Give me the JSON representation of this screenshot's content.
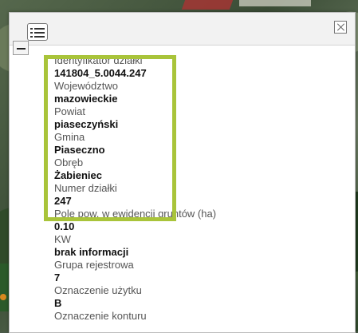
{
  "popup": {
    "fields": [
      {
        "label": "Identyfikator działki",
        "value": "141804_5.0044.247"
      },
      {
        "label": "Województwo",
        "value": "mazowieckie"
      },
      {
        "label": "Powiat",
        "value": "piaseczyński"
      },
      {
        "label": "Gmina",
        "value": "Piaseczno"
      },
      {
        "label": "Obręb",
        "value": "Żabieniec"
      },
      {
        "label": "Numer działki",
        "value": "247"
      },
      {
        "label": "Pole pow. w ewidencji gruntów (ha)",
        "value": "0.10"
      },
      {
        "label": "KW",
        "value": "brak informacji"
      },
      {
        "label": "Grupa rejestrowa",
        "value": "7"
      },
      {
        "label": "Oznaczenie użytku",
        "value": "B"
      },
      {
        "label": "Oznaczenie konturu",
        "value": ""
      }
    ]
  },
  "colors": {
    "highlight": "#a9c43a",
    "popup_bg": "#ffffff"
  }
}
